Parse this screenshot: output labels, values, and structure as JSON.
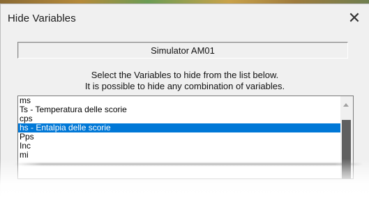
{
  "dialog": {
    "title": "Hide Variables",
    "close_icon": "close-icon",
    "close_glyph": "✕"
  },
  "simulator": {
    "label": "Simulator AM01"
  },
  "instructions": {
    "line1": "Select the Variables to hide from the list below.",
    "line2": "It is possible to hide any combination of variables."
  },
  "variables": {
    "items": [
      {
        "label": "ms",
        "selected": false
      },
      {
        "label": "Ts - Temperatura delle scorie",
        "selected": false
      },
      {
        "label": "cps",
        "selected": false
      },
      {
        "label": "hs - Entalpia delle scorie",
        "selected": true
      },
      {
        "label": "Pps",
        "selected": false
      },
      {
        "label": "Inc",
        "selected": false
      },
      {
        "label": "mi",
        "selected": false
      },
      {
        "label": "",
        "selected": false
      }
    ],
    "selection_color": "#0078d7"
  },
  "scrollbar": {
    "up_icon": "chevron-up-icon"
  }
}
